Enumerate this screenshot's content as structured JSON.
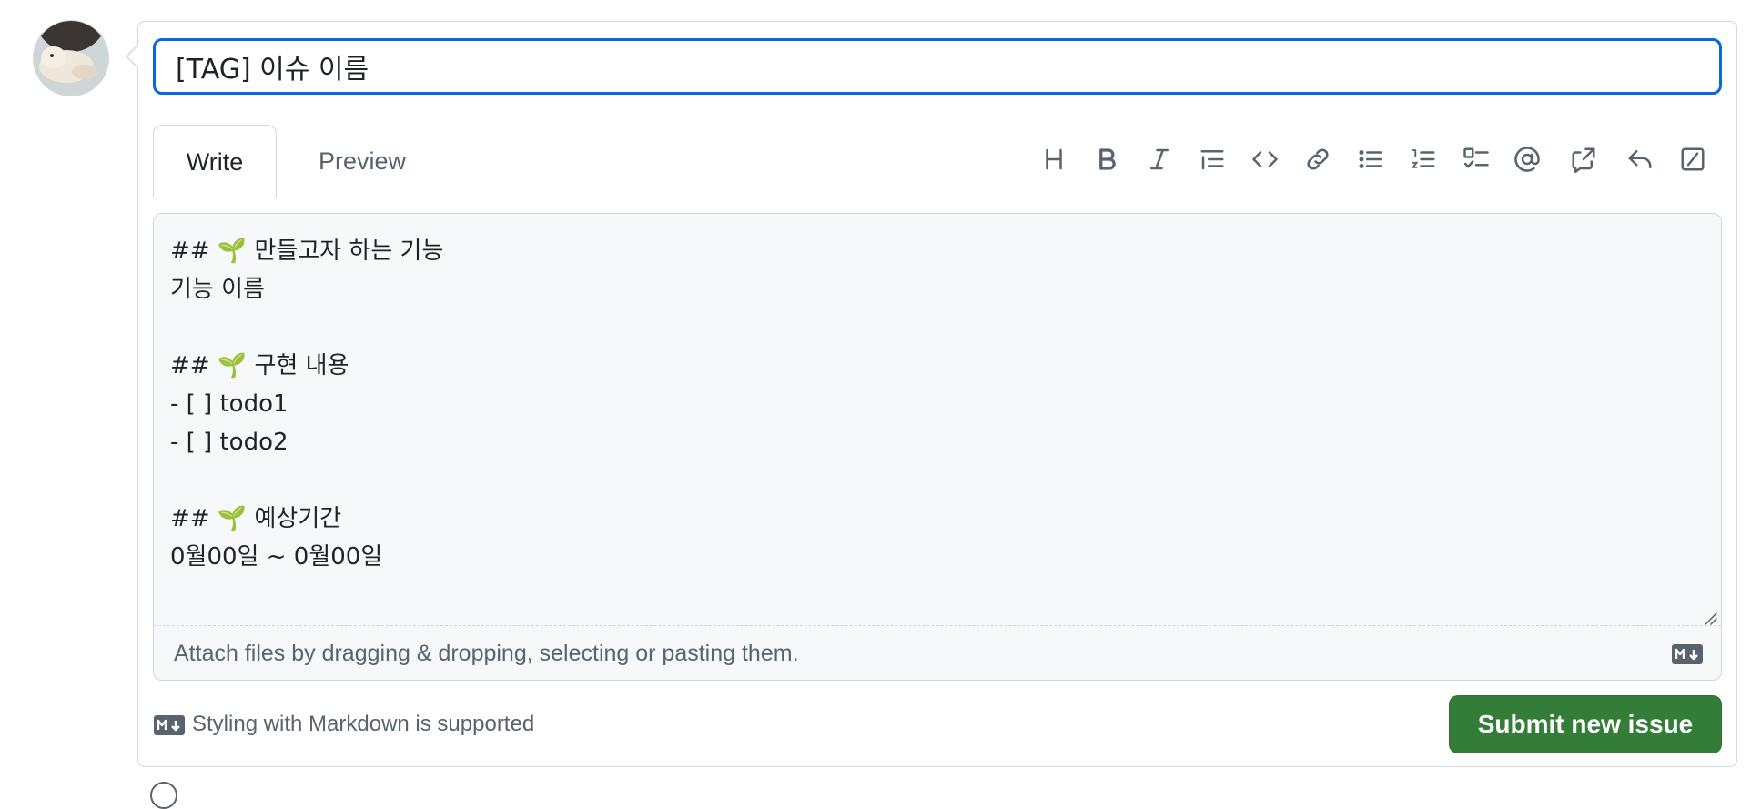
{
  "issue": {
    "title_value": "[TAG] 이슈 이름"
  },
  "tabs": {
    "write_label": "Write",
    "preview_label": "Preview"
  },
  "toolbar": {
    "icons": [
      "heading-icon",
      "bold-icon",
      "italic-icon",
      "quote-icon",
      "code-icon",
      "link-icon",
      "bulleted-list-icon",
      "numbered-list-icon",
      "task-list-icon",
      "mention-icon",
      "cross-reference-icon",
      "saved-replies-icon",
      "slash-commands-icon"
    ]
  },
  "editor": {
    "body": "## 🌱 만들고자 하는 기능\n기능 이름\n\n## 🌱 구현 내용\n- [ ] todo1\n- [ ] todo2\n\n## 🌱 예상기간\n0월00일 ~ 0월00일",
    "attach_hint": "Attach files by dragging & dropping, selecting or pasting them."
  },
  "footer": {
    "markdown_note": "Styling with Markdown is supported",
    "submit_label": "Submit new issue"
  },
  "colors": {
    "accent_blue": "#0969da",
    "submit_green": "#347d39",
    "muted_text": "#59636e",
    "border": "#d0d7de"
  }
}
